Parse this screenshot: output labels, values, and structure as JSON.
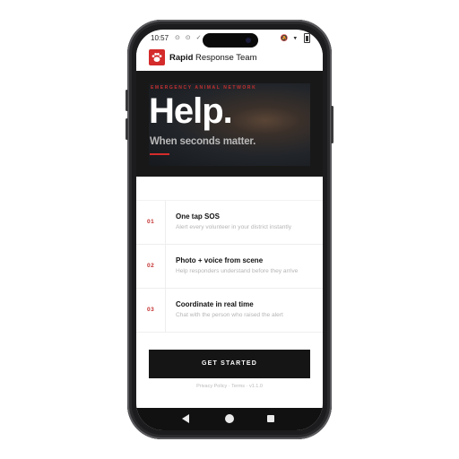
{
  "status_bar": {
    "time": "10:57",
    "left_icons": "⊙ ⊙ ✓",
    "right_icons": "🔕 ▾ ▮"
  },
  "app_bar": {
    "title_bold": "Rapid",
    "title_rest": " Response Team",
    "logo_icon": "paw-icon",
    "brand_color": "#d42b2b"
  },
  "hero": {
    "eyebrow": "EMERGENCY ANIMAL NETWORK",
    "title": "Help.",
    "subtitle": "When seconds matter."
  },
  "features": [
    {
      "num": "01",
      "title": "One tap SOS",
      "desc": "Alert every volunteer in your district instantly"
    },
    {
      "num": "02",
      "title": "Photo + voice from scene",
      "desc": "Help responders understand before they arrive"
    },
    {
      "num": "03",
      "title": "Coordinate in real time",
      "desc": "Chat with the person who raised the alert"
    }
  ],
  "cta": {
    "label": "GET STARTED"
  },
  "footer": {
    "links": "Privacy Policy · Terms · v1.1.0"
  }
}
